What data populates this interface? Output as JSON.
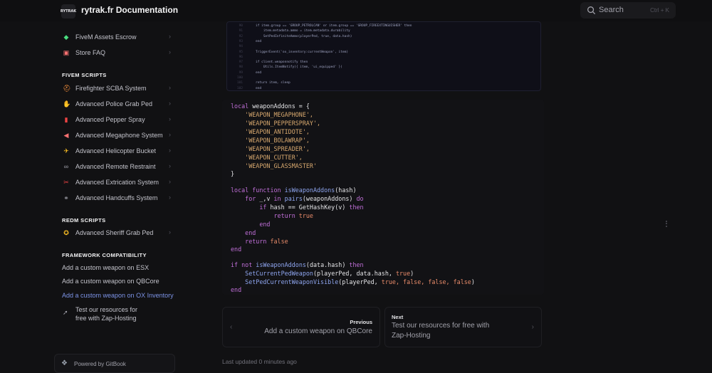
{
  "header": {
    "logo_text": "RYTRAK",
    "title": "rytrak.fr Documentation",
    "search_label": "Search",
    "search_shortcut": "Ctrl + K",
    "search_icon": "search-icon"
  },
  "sidebar": {
    "top_items": [
      {
        "label": "FiveM Assets Escrow",
        "icon": "shield-icon"
      },
      {
        "label": "Store FAQ",
        "icon": "store-icon"
      }
    ],
    "section_fivem": "FIVEM SCRIPTS",
    "fivem_items": [
      {
        "label": "Firefighter SCBA System",
        "icon": "scba-icon"
      },
      {
        "label": "Advanced Police Grab Ped",
        "icon": "grab-icon"
      },
      {
        "label": "Advanced Pepper Spray",
        "icon": "spray-icon"
      },
      {
        "label": "Advanced Megaphone System",
        "icon": "megaphone-icon"
      },
      {
        "label": "Advanced Helicopter Bucket",
        "icon": "helicopter-icon"
      },
      {
        "label": "Advanced Remote Restraint",
        "icon": "restraint-icon"
      },
      {
        "label": "Advanced Extrication System",
        "icon": "extrication-icon"
      },
      {
        "label": "Advanced Handcuffs System",
        "icon": "handcuffs-icon"
      }
    ],
    "section_redm": "REDM SCRIPTS",
    "redm_items": [
      {
        "label": "Advanced Sheriff Grab Ped",
        "icon": "sheriff-icon"
      }
    ],
    "section_framework": "FRAMEWORK COMPATIBILITY",
    "framework_items": [
      {
        "label": "Add a custom weapon on ESX"
      },
      {
        "label": "Add a custom weapon on QBCore"
      },
      {
        "label": "Add a custom weapon on OX Inventory",
        "active": true
      }
    ],
    "test_item": {
      "line1": "Test our resources for",
      "line2": "free with Zap-Hosting",
      "icon": "rocket-icon"
    },
    "gitbook": "Powered by GitBook"
  },
  "code_top": {
    "lines": [
      {
        "n": "90",
        "t": "if item.group == 'GROUP_PETROLCAN' or item.group == 'GROUP_FIREEXTINGUISHER' then"
      },
      {
        "n": "91",
        "t": "    item.metadata.ammo = item.metadata.durability"
      },
      {
        "n": "92",
        "t": "    SetPedInfiniteAmmo(playerPed, true, data.hash)"
      },
      {
        "n": "93",
        "t": "end"
      },
      {
        "n": "94",
        "t": ""
      },
      {
        "n": "95",
        "t": "TriggerEvent('ox_inventory:currentWeapon', item)"
      },
      {
        "n": "96",
        "t": ""
      },
      {
        "n": "97",
        "t": "if client.weaponnotify then"
      },
      {
        "n": "98",
        "t": "    Utils.ItemNotify({ item, 'ui_equipped' })"
      },
      {
        "n": "99",
        "t": "end"
      },
      {
        "n": "100",
        "t": ""
      },
      {
        "n": "101",
        "t": "return item, sleep"
      },
      {
        "n": "102",
        "t": "end"
      }
    ]
  },
  "code_main": {
    "l01_kw": "local",
    "l01_rest": " weaponAddons = {",
    "l02": "    'WEAPON_MEGAPHONE',",
    "l03": "    'WEAPON_PEPPERSPRAY',",
    "l04": "    'WEAPON_ANTIDOTE',",
    "l05": "    'WEAPON_BOLAWRAP',",
    "l06": "    'WEAPON_SPREADER',",
    "l07": "    'WEAPON_CUTTER',",
    "l08": "    'WEAPON_GLASSMASTER'",
    "l09": "}",
    "l11_kw": "local function",
    "l11_fn": " isWeaponAddons",
    "l11_rest": "(hash)",
    "l12_kw1": "    for",
    "l12_a": " _,v ",
    "l12_kw2": "in",
    "l12_fn": " pairs",
    "l12_b": "(weaponAddons) ",
    "l12_kw3": "do",
    "l13_kw1": "        if",
    "l13_a": " hash == GetHashKey(v) ",
    "l13_kw2": "then",
    "l14_kw": "            return",
    "l14_b": " true",
    "l15": "        end",
    "l16": "    end",
    "l17_kw": "    return",
    "l17_b": " false",
    "l18": "end",
    "l20_kw1": "if not",
    "l20_fn": " isWeaponAddons",
    "l20_a": "(data.hash) ",
    "l20_kw2": "then",
    "l21_fn": "    SetCurrentPedWeapon",
    "l21_a": "(playerPed, data.hash, ",
    "l21_b": "true",
    "l21_c": ")",
    "l22_fn": "    SetPedCurrentWeaponVisible",
    "l22_a": "(playerPed, ",
    "l22_b": "true, false, false, false",
    "l22_c": ")",
    "l23": "end"
  },
  "pagination": {
    "prev_small": "Previous",
    "prev_title": "Add a custom weapon on QBCore",
    "next_small": "Next",
    "next_title_1": "Test our resources for free with",
    "next_title_2": "Zap-Hosting"
  },
  "footer": {
    "updated": "Last updated 0 minutes ago"
  }
}
